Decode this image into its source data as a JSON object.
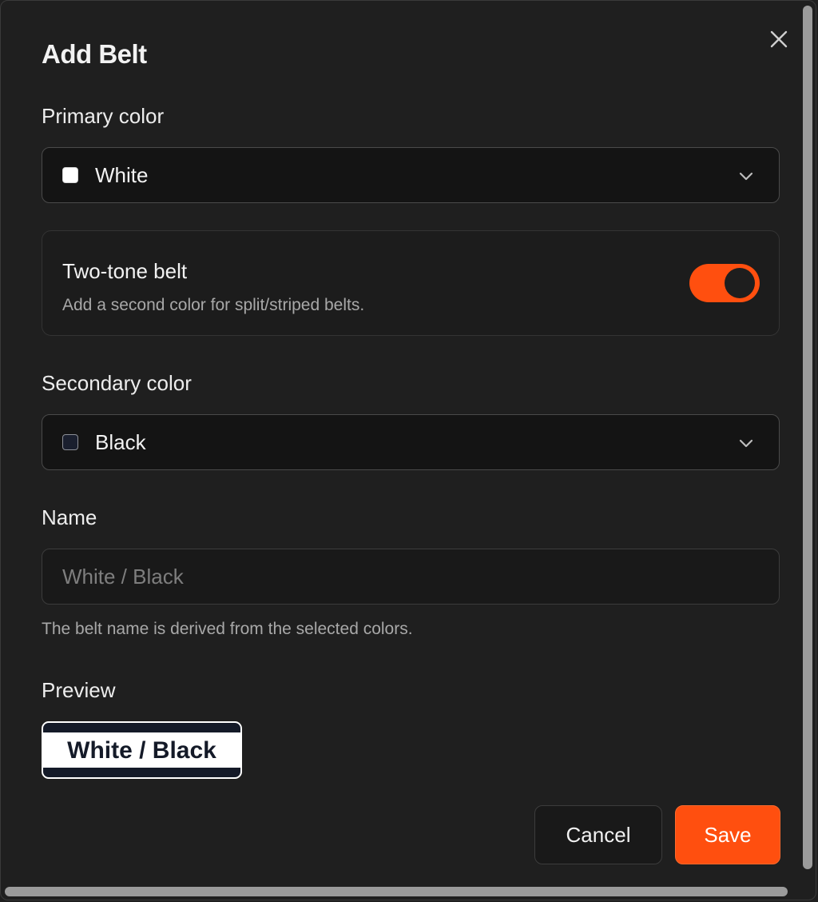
{
  "dialog": {
    "title": "Add Belt",
    "close_icon": "close-icon"
  },
  "primary": {
    "label": "Primary color",
    "value": "White",
    "swatch_color": "#ffffff",
    "chevron_icon": "chevron-down-icon"
  },
  "two_tone": {
    "title": "Two-tone belt",
    "description": "Add a second color for split/striped belts.",
    "enabled": true,
    "accent": "#ff4f0f"
  },
  "secondary": {
    "label": "Secondary color",
    "value": "Black",
    "swatch_color": "#1a1f2e",
    "chevron_icon": "chevron-down-icon"
  },
  "name": {
    "label": "Name",
    "placeholder": "White / Black",
    "help": "The belt name is derived from the selected colors."
  },
  "preview": {
    "label": "Preview",
    "badge_text": "White / Black",
    "primary_color": "#ffffff",
    "stripe_color": "#141a28"
  },
  "actions": {
    "cancel_label": "Cancel",
    "save_label": "Save"
  }
}
